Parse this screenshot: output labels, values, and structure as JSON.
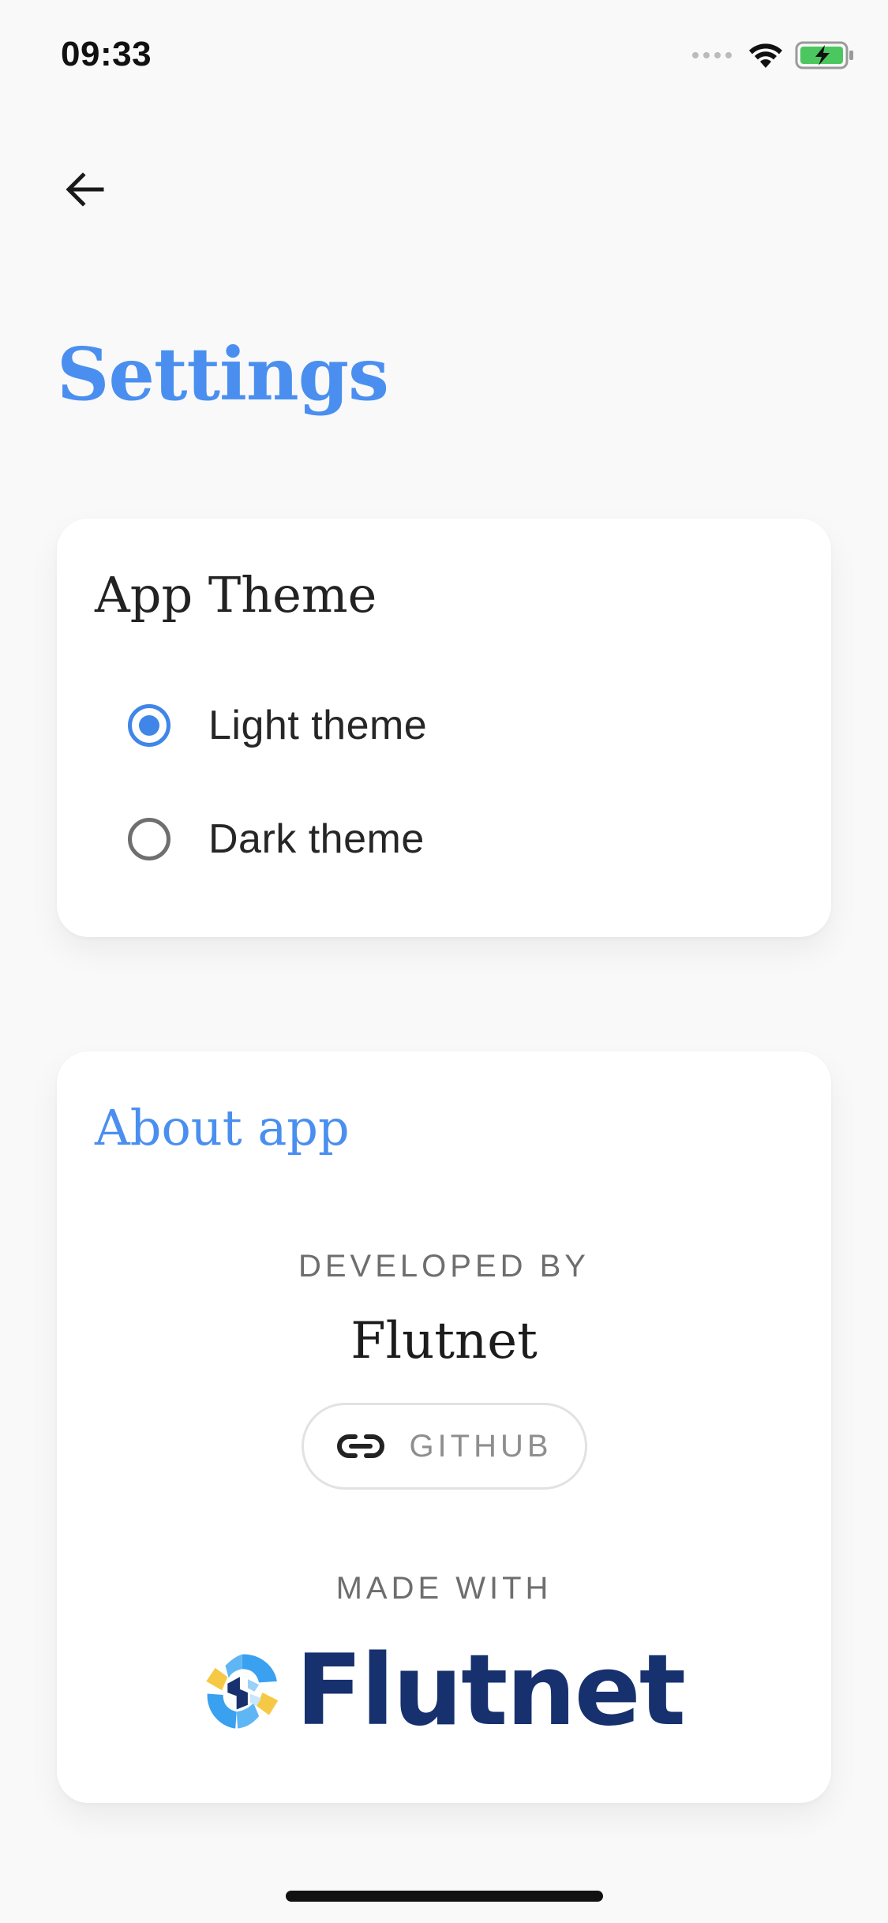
{
  "status_bar": {
    "time": "09:33"
  },
  "header": {
    "title": "Settings"
  },
  "theme_card": {
    "heading": "App Theme",
    "options": [
      {
        "label": "Light theme",
        "selected": true
      },
      {
        "label": "Dark theme",
        "selected": false
      }
    ]
  },
  "about_card": {
    "heading": "About app",
    "developed_by_label": "DEVELOPED BY",
    "developer": "Flutnet",
    "github_label": "GITHUB",
    "made_with_label": "MADE WITH",
    "logo_text": "Flutnet"
  },
  "colors": {
    "accent": "#4a8ff0",
    "logo_navy": "#17306e",
    "logo_yellow": "#f6c945",
    "logo_blue": "#3aa0f0"
  }
}
